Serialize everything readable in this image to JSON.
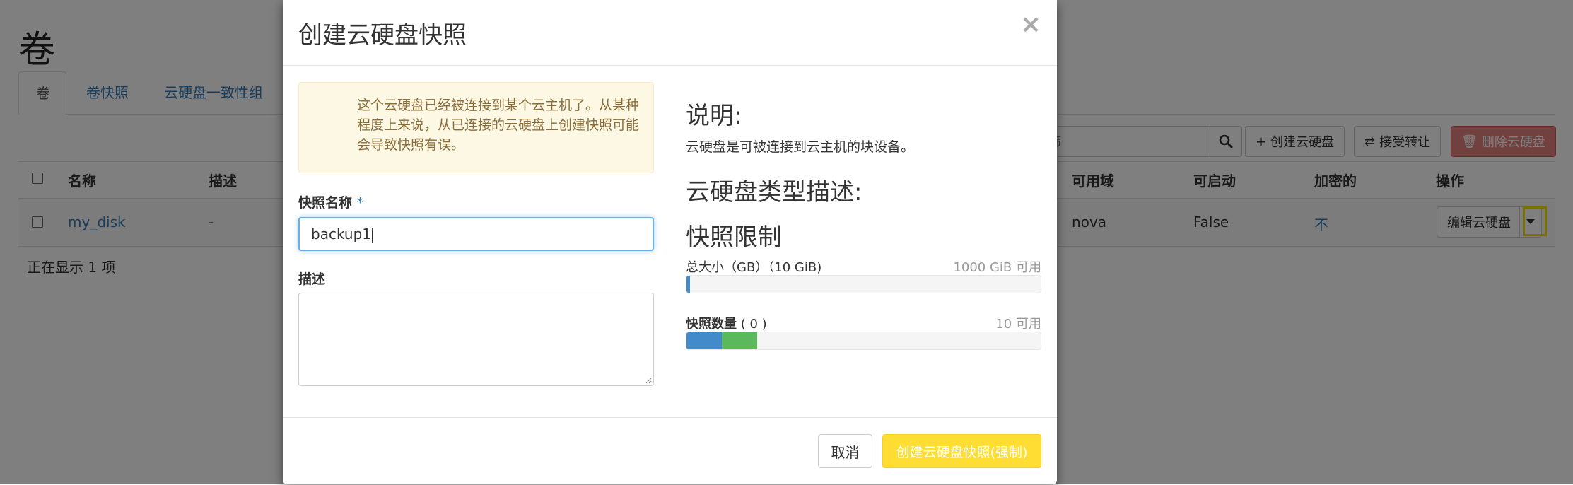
{
  "page": {
    "title": "卷",
    "tabs": [
      {
        "label": "卷",
        "active": true
      },
      {
        "label": "卷快照",
        "active": false
      },
      {
        "label": "云硬盘一致性组",
        "active": false
      }
    ],
    "search_placeholder": "筛",
    "buttons": {
      "create": "创建云硬盘",
      "accept_transfer": "接受转让",
      "delete": "删除云硬盘"
    },
    "table": {
      "headers": {
        "name": "名称",
        "description": "描述",
        "availability_zone": "可用域",
        "bootable": "可启动",
        "encrypted": "加密的",
        "actions": "操作"
      },
      "rows": [
        {
          "name": "my_disk",
          "description": "-",
          "availability_zone": "nova",
          "bootable": "False",
          "encrypted": "不",
          "action_label": "编辑云硬盘"
        }
      ]
    },
    "footer": "正在显示 1 项"
  },
  "modal": {
    "title": "创建云硬盘快照",
    "close_symbol": "×",
    "warning": "这个云硬盘已经被连接到某个云主机了。从某种程度上来说，从已连接的云硬盘上创建快照可能会导致快照有误。",
    "snapshot_name_label": "快照名称",
    "required_mark": "*",
    "snapshot_name_value": "backup1",
    "description_label": "描述",
    "description_value": "",
    "info": {
      "heading": "说明:",
      "text": "云硬盘是可被连接到云主机的块设备。",
      "type_heading": "云硬盘类型描述:",
      "limits_heading": "快照限制",
      "quota_size_label": "总大小（GB）（10 GiB)",
      "quota_size_available": "1000 GiB 可用",
      "quota_size_fraction": 0.01,
      "quota_count_label": "快照数量",
      "quota_count_value": "( 0 )",
      "quota_count_available": "10 可用",
      "quota_count_used_fraction": 0.1,
      "quota_count_new_fraction": 0.1
    },
    "buttons": {
      "cancel": "取消",
      "submit": "创建云硬盘快照(强制)"
    }
  },
  "colors": {
    "link": "#337ab7",
    "warning_bg": "#fcf8e3",
    "warning_text": "#8a6d3b",
    "primary_yellow": "#ffdd33",
    "bar_used": "#428bca",
    "bar_new": "#5cb85c",
    "danger": "#d9534f",
    "highlight": "#f5e000"
  }
}
